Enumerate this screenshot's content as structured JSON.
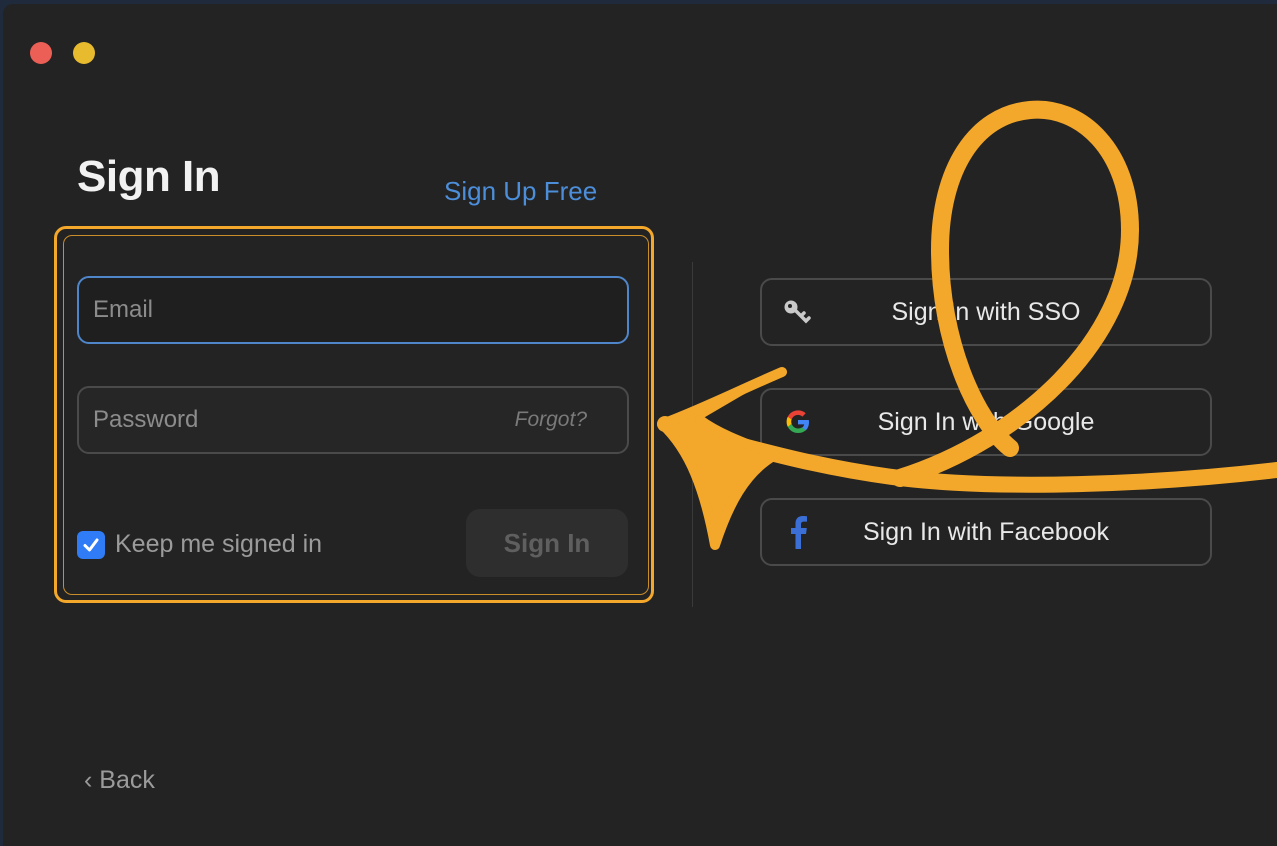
{
  "window": {
    "traffic_lights": [
      {
        "name": "close",
        "color": "#ec5f57"
      },
      {
        "name": "minimize",
        "color": "#e8bb2e"
      }
    ]
  },
  "header": {
    "title": "Sign In",
    "signup_link": "Sign Up Free"
  },
  "form": {
    "email": {
      "placeholder": "Email",
      "value": ""
    },
    "password": {
      "placeholder": "Password",
      "value": ""
    },
    "forgot_label": "Forgot?",
    "keep_signed_in": {
      "label": "Keep me signed in",
      "checked": true
    },
    "signin_button": "Sign In"
  },
  "providers": [
    {
      "label": "Sign In with SSO",
      "icon": "key-icon"
    },
    {
      "label": "Sign In with Google",
      "icon": "google-icon"
    },
    {
      "label": "Sign In with Facebook",
      "icon": "facebook-icon"
    }
  ],
  "footer": {
    "back_label": "Back"
  },
  "colors": {
    "accent": "#4c8ed9",
    "annotation": "#f3a72b",
    "checkbox": "#2f7cf6",
    "background": "#232323"
  }
}
